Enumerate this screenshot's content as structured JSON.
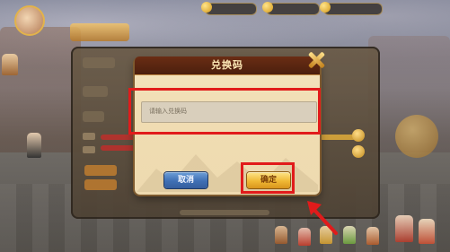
{
  "dialog": {
    "title": "兑换码",
    "input": {
      "value": "",
      "placeholder": "请输入兑换码"
    },
    "cancel_label": "取消",
    "confirm_label": "确定"
  },
  "annotations": {
    "highlight_color": "#e11b1b"
  },
  "colors": {
    "dialog_header": "#4b1f0d",
    "dialog_body": "#f0ddb2",
    "cancel_button": "#3f6fb4",
    "confirm_button": "#f0b935"
  }
}
